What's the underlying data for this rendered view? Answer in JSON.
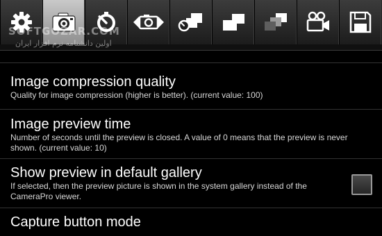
{
  "tabs": [
    {
      "icon": "gear-icon",
      "selected": false
    },
    {
      "icon": "camera-icon",
      "selected": true
    },
    {
      "icon": "self-timer-icon",
      "selected": false
    },
    {
      "icon": "panorama-camera-icon",
      "selected": false
    },
    {
      "icon": "timer-burst-icon",
      "selected": false
    },
    {
      "icon": "burst-icon",
      "selected": false
    },
    {
      "icon": "bracketing-icon",
      "selected": false
    },
    {
      "icon": "video-camera-icon",
      "selected": false
    },
    {
      "icon": "save-icon",
      "selected": false
    }
  ],
  "watermark": {
    "text": "SOFTGOZAR.COM",
    "subtext": "اولین دانشنامه نرم افزار ایران"
  },
  "preferences": [
    {
      "title": "Image compression quality",
      "summary": "Quality for image compression (higher is better). (current value: 100)"
    },
    {
      "title": "Image preview time",
      "summary": "Number of seconds until the preview is closed. A value of 0 means that the preview is never shown. (current value: 10)"
    },
    {
      "title": "Show preview in default gallery",
      "summary": "If selected, then the preview picture is shown in the system gallery instead of the CameraPro viewer.",
      "checked": false
    },
    {
      "title": "Capture button mode",
      "summary": ""
    }
  ],
  "colors": {
    "background": "#000000",
    "selected_tab": "#b5b5b5",
    "tab": "#2c2c2c",
    "divider": "#333333"
  }
}
